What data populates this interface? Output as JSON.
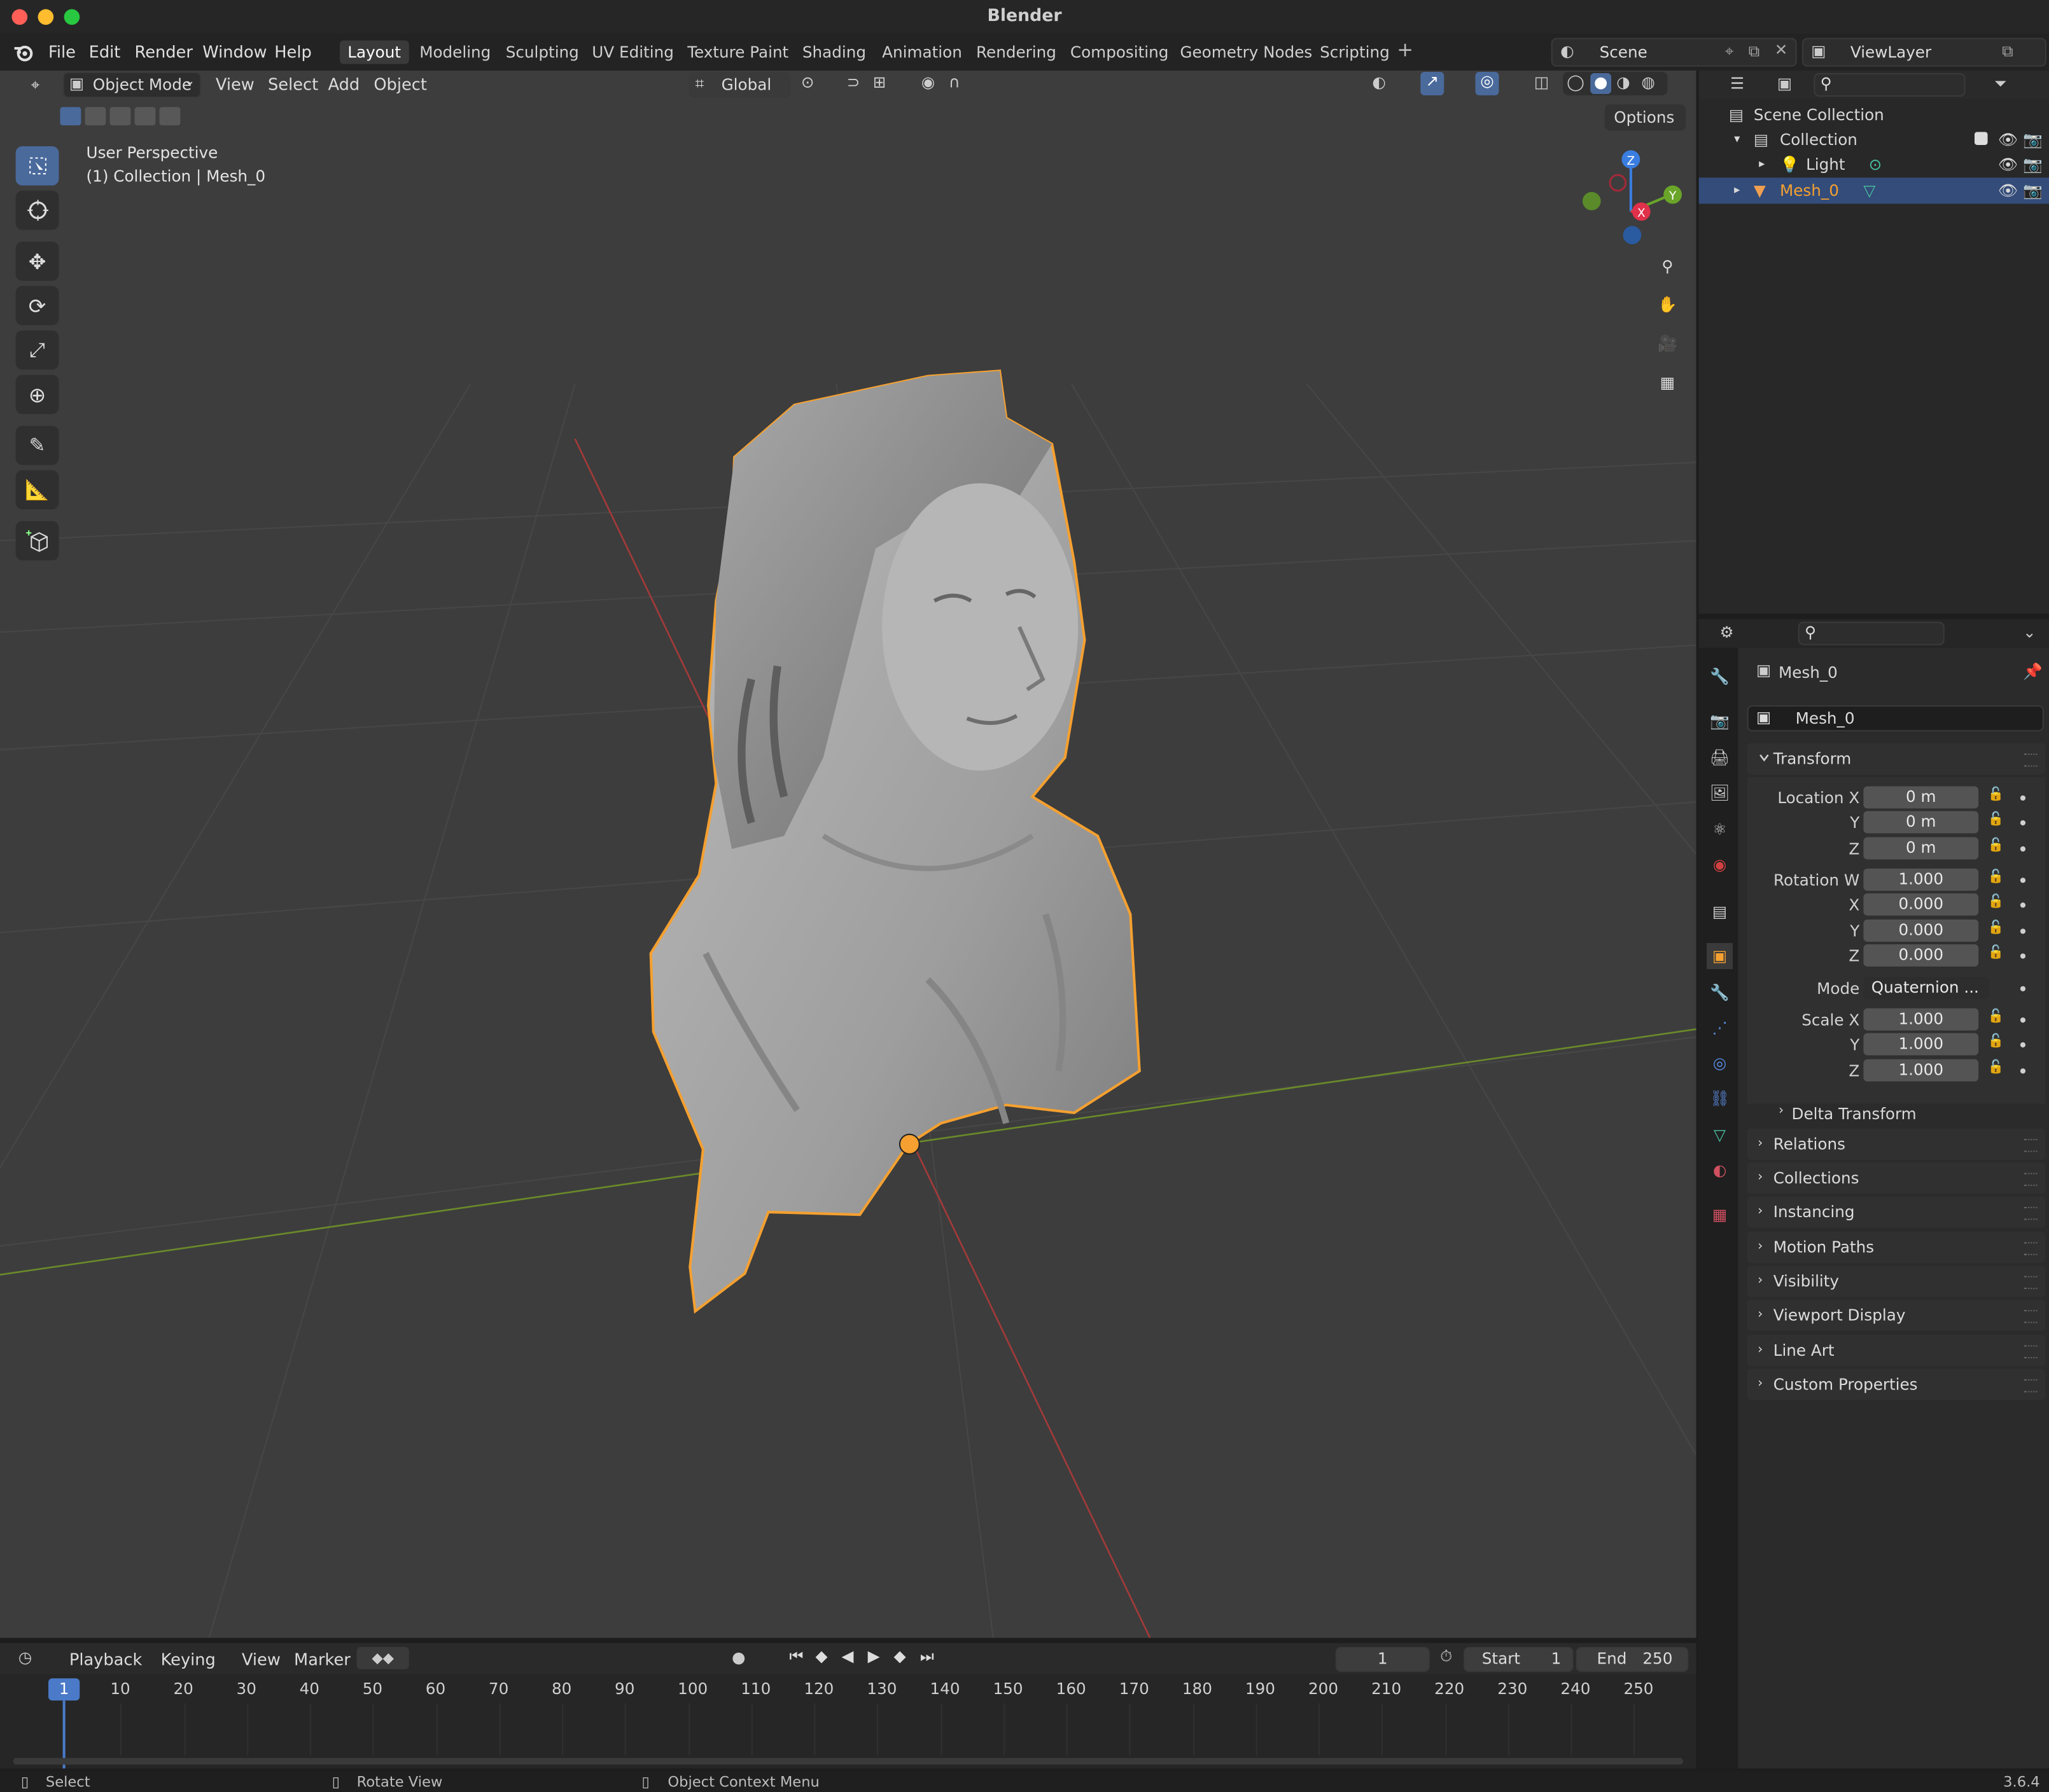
{
  "window": {
    "title": "Blender",
    "version": "3.6.4"
  },
  "menus": [
    "File",
    "Edit",
    "Render",
    "Window",
    "Help"
  ],
  "workspaces": [
    "Layout",
    "Modeling",
    "Sculpting",
    "UV Editing",
    "Texture Paint",
    "Shading",
    "Animation",
    "Rendering",
    "Compositing",
    "Geometry Nodes",
    "Scripting"
  ],
  "scene": {
    "scene_name": "Scene",
    "viewlayer": "ViewLayer"
  },
  "viewport": {
    "mode": "Object Mode",
    "header_menus": [
      "View",
      "Select",
      "Add",
      "Object"
    ],
    "orientation": "Global",
    "options": "Options",
    "info_line1": "User Perspective",
    "info_line2": "(1) Collection | Mesh_0",
    "gizmo": {
      "z": "Z",
      "y": "Y",
      "x": "X"
    },
    "selected_outline_color": "#f5a030"
  },
  "outliner": {
    "root": "Scene Collection",
    "collection": "Collection",
    "items": [
      "Light",
      "Mesh_0"
    ],
    "selected": "Mesh_0"
  },
  "properties": {
    "object_name": "Mesh_0",
    "datablock_name": "Mesh_0",
    "transform": {
      "header": "Transform",
      "location_label": "Location X",
      "location": [
        "0 m",
        "0 m",
        "0 m"
      ],
      "rotation_label": "Rotation W",
      "rotation": [
        "1.000",
        "0.000",
        "0.000",
        "0.000"
      ],
      "mode_label": "Mode",
      "mode": "Quaternion ...",
      "scale_label": "Scale X",
      "scale": [
        "1.000",
        "1.000",
        "1.000"
      ],
      "axis_y": "Y",
      "axis_z": "Z",
      "axis_x": "X"
    },
    "delta_transform": "Delta Transform",
    "panels": [
      "Relations",
      "Collections",
      "Instancing",
      "Motion Paths",
      "Visibility",
      "Viewport Display",
      "Line Art",
      "Custom Properties"
    ]
  },
  "timeline": {
    "menus": [
      "Playback",
      "Keying",
      "View",
      "Marker"
    ],
    "current_frame": "1",
    "start_label": "Start",
    "start": "1",
    "end_label": "End",
    "end": "250",
    "ticks": [
      "10",
      "20",
      "30",
      "40",
      "50",
      "60",
      "70",
      "80",
      "90",
      "100",
      "110",
      "120",
      "130",
      "140",
      "150",
      "160",
      "170",
      "180",
      "190",
      "200",
      "210",
      "220",
      "230",
      "240",
      "250"
    ]
  },
  "statusbar": {
    "left": "Select",
    "middle": "Rotate View",
    "right": "Object Context Menu"
  }
}
